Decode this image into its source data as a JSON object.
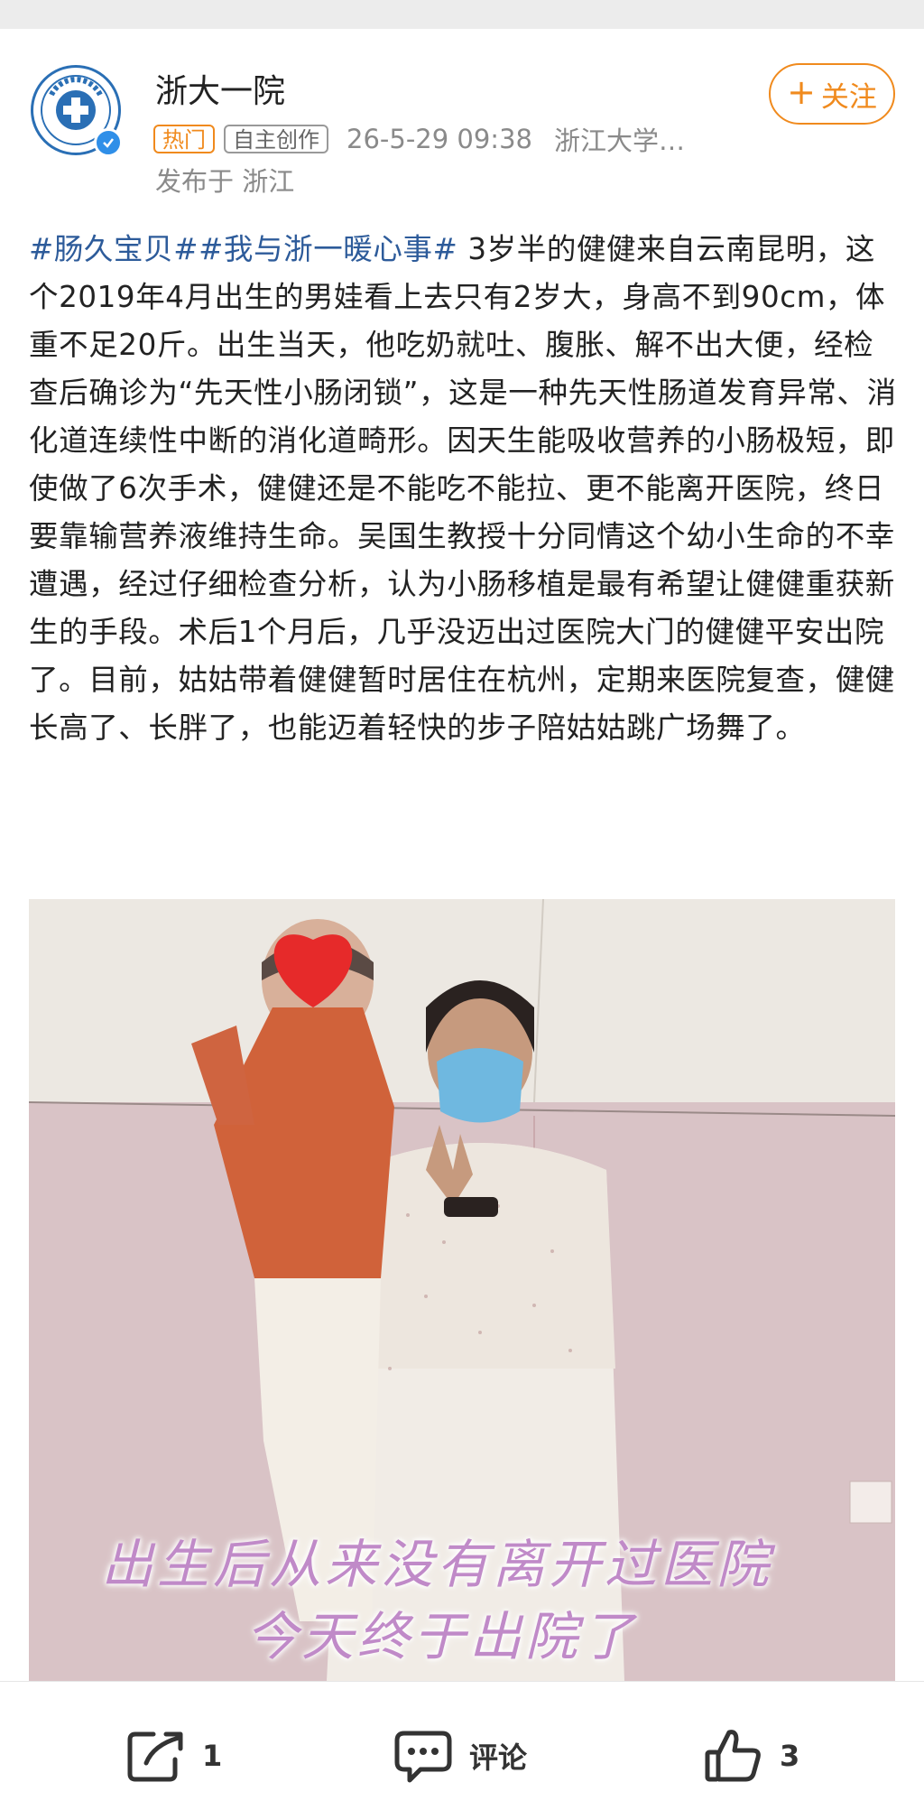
{
  "header": {
    "author_name": "浙大一院",
    "follow_label": "关注",
    "follow_icon": "plus-icon",
    "badge_hot": "热门",
    "badge_original": "自主创作",
    "timestamp": "26-5-29 09:38",
    "source": "浙江大学…",
    "location": "发布于 浙江",
    "avatar_icon": "hospital-logo-icon",
    "verified_icon": "verified-check-icon"
  },
  "post": {
    "hashtag1": "#肠久宝贝#",
    "hashtag2": "#我与浙一暖心事#",
    "body": " 3岁半的健健来自云南昆明，这个2019年4月出生的男娃看上去只有2岁大，身高不到90cm，体重不足20斤。出生当天，他吃奶就吐、腹胀、解不出大便，经检查后确诊为“先天性小肠闭锁”，这是一种先天性肠道发育异常、消化道连续性中断的消化道畸形。因天生能吸收营养的小肠极短，即使做了6次手术，健健还是不能吃不能拉、更不能离开医院，终日要靠输营养液维持生命。吴国生教授十分同情这个幼小生命的不幸遭遇，经过仔细检查分析，认为小肠移植是最有希望让健健重获新生的手段。术后1个月后，几乎没迈出过医院大门的健健平安出院了。目前，姑姑带着健健暂时居住在杭州，定期来医院复查，健健长高了、长胖了，也能迈着轻快的步子陪姑姑跳广场舞了。"
  },
  "photo": {
    "caption_line1": "出生后从来没有离开过医院",
    "caption_line2": "今天终于出院了"
  },
  "actions": {
    "share_count": "1",
    "comment_label": "评论",
    "like_count": "3",
    "share_icon": "share-icon",
    "comment_icon": "comment-icon",
    "like_icon": "thumbs-up-icon"
  },
  "colors": {
    "accent_orange": "#f08a1d",
    "hashtag_blue": "#2d5b9a",
    "verified_blue": "#2f8fe8"
  }
}
